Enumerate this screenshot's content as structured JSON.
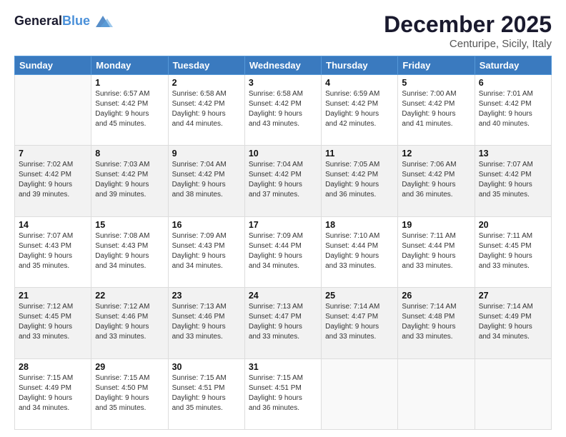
{
  "header": {
    "logo_line1": "General",
    "logo_line2": "Blue",
    "month": "December 2025",
    "location": "Centuripe, Sicily, Italy"
  },
  "days_of_week": [
    "Sunday",
    "Monday",
    "Tuesday",
    "Wednesday",
    "Thursday",
    "Friday",
    "Saturday"
  ],
  "weeks": [
    [
      {
        "day": "",
        "text": ""
      },
      {
        "day": "1",
        "text": "Sunrise: 6:57 AM\nSunset: 4:42 PM\nDaylight: 9 hours\nand 45 minutes."
      },
      {
        "day": "2",
        "text": "Sunrise: 6:58 AM\nSunset: 4:42 PM\nDaylight: 9 hours\nand 44 minutes."
      },
      {
        "day": "3",
        "text": "Sunrise: 6:58 AM\nSunset: 4:42 PM\nDaylight: 9 hours\nand 43 minutes."
      },
      {
        "day": "4",
        "text": "Sunrise: 6:59 AM\nSunset: 4:42 PM\nDaylight: 9 hours\nand 42 minutes."
      },
      {
        "day": "5",
        "text": "Sunrise: 7:00 AM\nSunset: 4:42 PM\nDaylight: 9 hours\nand 41 minutes."
      },
      {
        "day": "6",
        "text": "Sunrise: 7:01 AM\nSunset: 4:42 PM\nDaylight: 9 hours\nand 40 minutes."
      }
    ],
    [
      {
        "day": "7",
        "text": "Sunrise: 7:02 AM\nSunset: 4:42 PM\nDaylight: 9 hours\nand 39 minutes."
      },
      {
        "day": "8",
        "text": "Sunrise: 7:03 AM\nSunset: 4:42 PM\nDaylight: 9 hours\nand 39 minutes."
      },
      {
        "day": "9",
        "text": "Sunrise: 7:04 AM\nSunset: 4:42 PM\nDaylight: 9 hours\nand 38 minutes."
      },
      {
        "day": "10",
        "text": "Sunrise: 7:04 AM\nSunset: 4:42 PM\nDaylight: 9 hours\nand 37 minutes."
      },
      {
        "day": "11",
        "text": "Sunrise: 7:05 AM\nSunset: 4:42 PM\nDaylight: 9 hours\nand 36 minutes."
      },
      {
        "day": "12",
        "text": "Sunrise: 7:06 AM\nSunset: 4:42 PM\nDaylight: 9 hours\nand 36 minutes."
      },
      {
        "day": "13",
        "text": "Sunrise: 7:07 AM\nSunset: 4:42 PM\nDaylight: 9 hours\nand 35 minutes."
      }
    ],
    [
      {
        "day": "14",
        "text": "Sunrise: 7:07 AM\nSunset: 4:43 PM\nDaylight: 9 hours\nand 35 minutes."
      },
      {
        "day": "15",
        "text": "Sunrise: 7:08 AM\nSunset: 4:43 PM\nDaylight: 9 hours\nand 34 minutes."
      },
      {
        "day": "16",
        "text": "Sunrise: 7:09 AM\nSunset: 4:43 PM\nDaylight: 9 hours\nand 34 minutes."
      },
      {
        "day": "17",
        "text": "Sunrise: 7:09 AM\nSunset: 4:44 PM\nDaylight: 9 hours\nand 34 minutes."
      },
      {
        "day": "18",
        "text": "Sunrise: 7:10 AM\nSunset: 4:44 PM\nDaylight: 9 hours\nand 33 minutes."
      },
      {
        "day": "19",
        "text": "Sunrise: 7:11 AM\nSunset: 4:44 PM\nDaylight: 9 hours\nand 33 minutes."
      },
      {
        "day": "20",
        "text": "Sunrise: 7:11 AM\nSunset: 4:45 PM\nDaylight: 9 hours\nand 33 minutes."
      }
    ],
    [
      {
        "day": "21",
        "text": "Sunrise: 7:12 AM\nSunset: 4:45 PM\nDaylight: 9 hours\nand 33 minutes."
      },
      {
        "day": "22",
        "text": "Sunrise: 7:12 AM\nSunset: 4:46 PM\nDaylight: 9 hours\nand 33 minutes."
      },
      {
        "day": "23",
        "text": "Sunrise: 7:13 AM\nSunset: 4:46 PM\nDaylight: 9 hours\nand 33 minutes."
      },
      {
        "day": "24",
        "text": "Sunrise: 7:13 AM\nSunset: 4:47 PM\nDaylight: 9 hours\nand 33 minutes."
      },
      {
        "day": "25",
        "text": "Sunrise: 7:14 AM\nSunset: 4:47 PM\nDaylight: 9 hours\nand 33 minutes."
      },
      {
        "day": "26",
        "text": "Sunrise: 7:14 AM\nSunset: 4:48 PM\nDaylight: 9 hours\nand 33 minutes."
      },
      {
        "day": "27",
        "text": "Sunrise: 7:14 AM\nSunset: 4:49 PM\nDaylight: 9 hours\nand 34 minutes."
      }
    ],
    [
      {
        "day": "28",
        "text": "Sunrise: 7:15 AM\nSunset: 4:49 PM\nDaylight: 9 hours\nand 34 minutes."
      },
      {
        "day": "29",
        "text": "Sunrise: 7:15 AM\nSunset: 4:50 PM\nDaylight: 9 hours\nand 35 minutes."
      },
      {
        "day": "30",
        "text": "Sunrise: 7:15 AM\nSunset: 4:51 PM\nDaylight: 9 hours\nand 35 minutes."
      },
      {
        "day": "31",
        "text": "Sunrise: 7:15 AM\nSunset: 4:51 PM\nDaylight: 9 hours\nand 36 minutes."
      },
      {
        "day": "",
        "text": ""
      },
      {
        "day": "",
        "text": ""
      },
      {
        "day": "",
        "text": ""
      }
    ]
  ]
}
